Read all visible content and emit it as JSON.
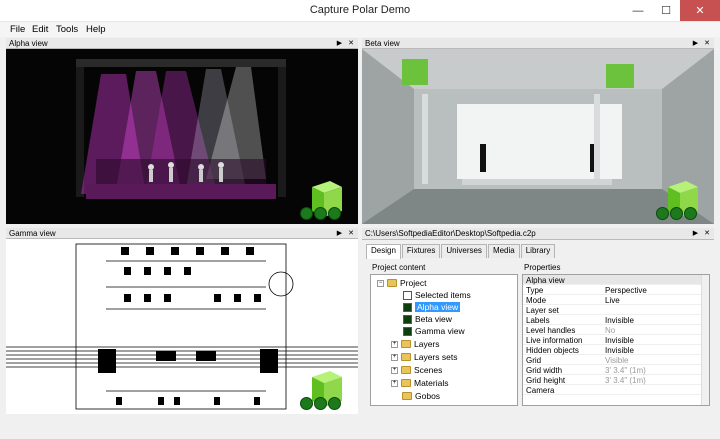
{
  "window": {
    "title": "Capture Polar Demo",
    "min": "—",
    "max": "☐",
    "close": "✕"
  },
  "menu": [
    "File",
    "Edit",
    "Tools",
    "Help"
  ],
  "panes": {
    "alpha": "Alpha view",
    "beta": "Beta view",
    "gamma": "Gamma view",
    "file_path": "C:\\Users\\SoftpediaEditor\\Desktop\\Softpedia.c2p",
    "header_buttons": "▶ ✕"
  },
  "tabs": [
    "Design",
    "Fixtures",
    "Universes",
    "Media",
    "Library"
  ],
  "project_content_label": "Project content",
  "properties_label": "Properties",
  "tree": [
    {
      "label": "Project",
      "expander": "−"
    },
    {
      "label": "Selected items"
    },
    {
      "label": "Alpha view"
    },
    {
      "label": "Beta view"
    },
    {
      "label": "Gamma view"
    },
    {
      "label": "Layers",
      "expander": "+"
    },
    {
      "label": "Layers sets",
      "expander": "+"
    },
    {
      "label": "Scenes",
      "expander": "+"
    },
    {
      "label": "Materials",
      "expander": "+"
    },
    {
      "label": "Gobos",
      "expander": ""
    }
  ],
  "properties": {
    "header": "Alpha view",
    "rows": [
      {
        "name": "Type",
        "value": "Perspective",
        "dim": false
      },
      {
        "name": "Mode",
        "value": "Live",
        "dim": false
      },
      {
        "name": "Layer set",
        "value": "",
        "dim": false
      },
      {
        "name": "Labels",
        "value": "Invisible",
        "dim": false
      },
      {
        "name": "Level handles",
        "value": "No",
        "dim": true
      },
      {
        "name": "Live information",
        "value": "Invisible",
        "dim": false
      },
      {
        "name": "Hidden objects",
        "value": "Invisible",
        "dim": false
      },
      {
        "name": "Grid",
        "value": "Visible",
        "dim": true
      },
      {
        "name": "Grid width",
        "value": "3' 3.4\" (1m)",
        "dim": true
      },
      {
        "name": "Grid height",
        "value": "3' 3.4\" (1m)",
        "dim": true
      },
      {
        "name": "Camera",
        "value": "",
        "dim": false
      }
    ]
  },
  "colors": {
    "accent_green": "#2e9e2e",
    "selection": "#3399ff",
    "beam": "#d63cd6"
  }
}
